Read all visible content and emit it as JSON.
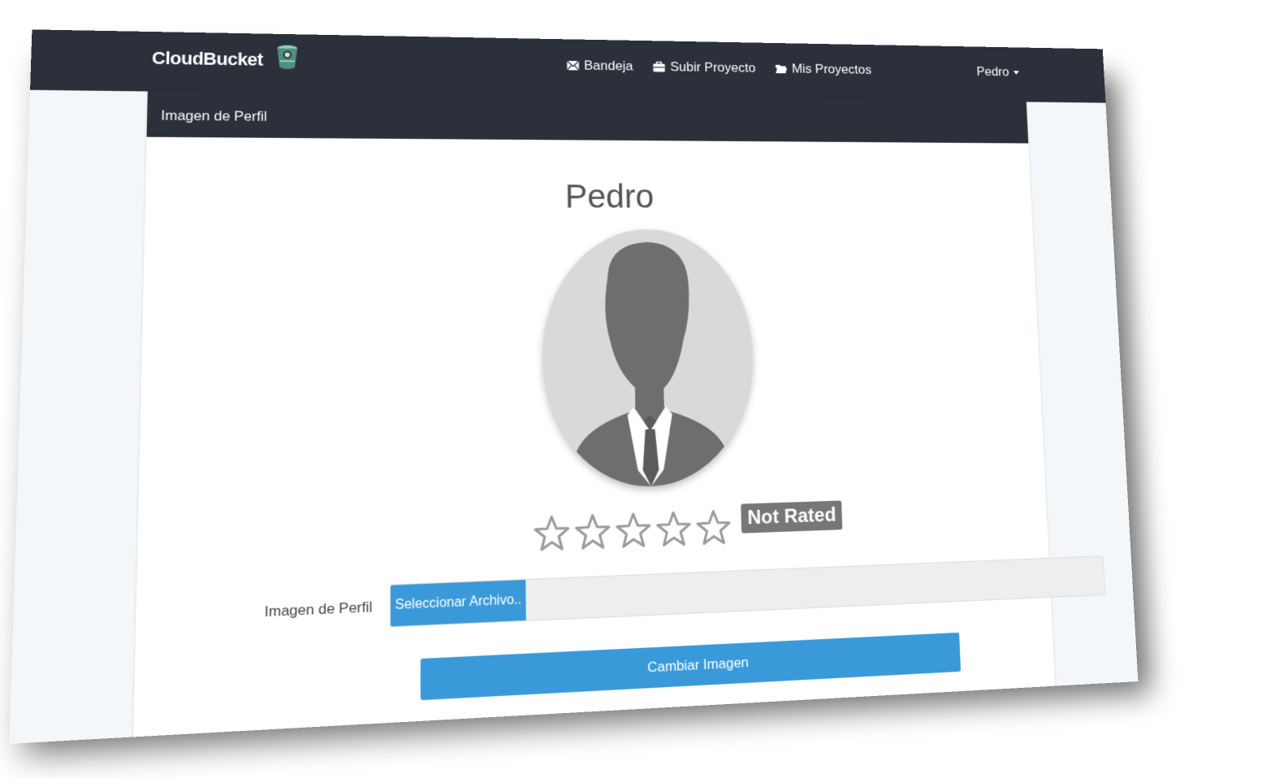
{
  "navbar": {
    "brand": "CloudBucket",
    "links": [
      {
        "label": "Bandeja",
        "icon": "envelope-icon"
      },
      {
        "label": "Subir Proyecto",
        "icon": "briefcase-icon"
      },
      {
        "label": "Mis Proyectos",
        "icon": "folder-open-icon"
      }
    ],
    "user": "Pedro"
  },
  "panel": {
    "heading": "Imagen de Perfil",
    "profile_name": "Pedro",
    "rating": {
      "stars_total": 5,
      "stars_filled": 0,
      "label": "Not Rated"
    },
    "form": {
      "label": "Imagen de Perfil",
      "file_button": "Seleccionar Archivo..",
      "submit": "Cambiar Imagen"
    }
  },
  "colors": {
    "navbar_bg": "#2c303b",
    "primary": "#3a9ad9",
    "badge": "#777777"
  }
}
